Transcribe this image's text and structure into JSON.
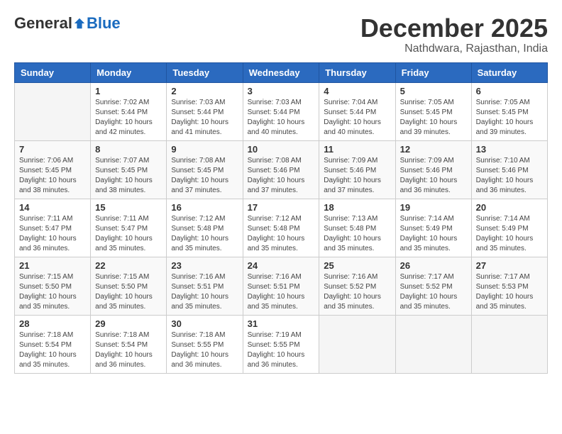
{
  "logo": {
    "general": "General",
    "blue": "Blue"
  },
  "header": {
    "month": "December 2025",
    "location": "Nathdwara, Rajasthan, India"
  },
  "weekdays": [
    "Sunday",
    "Monday",
    "Tuesday",
    "Wednesday",
    "Thursday",
    "Friday",
    "Saturday"
  ],
  "weeks": [
    [
      {
        "day": "",
        "info": ""
      },
      {
        "day": "1",
        "info": "Sunrise: 7:02 AM\nSunset: 5:44 PM\nDaylight: 10 hours\nand 42 minutes."
      },
      {
        "day": "2",
        "info": "Sunrise: 7:03 AM\nSunset: 5:44 PM\nDaylight: 10 hours\nand 41 minutes."
      },
      {
        "day": "3",
        "info": "Sunrise: 7:03 AM\nSunset: 5:44 PM\nDaylight: 10 hours\nand 40 minutes."
      },
      {
        "day": "4",
        "info": "Sunrise: 7:04 AM\nSunset: 5:44 PM\nDaylight: 10 hours\nand 40 minutes."
      },
      {
        "day": "5",
        "info": "Sunrise: 7:05 AM\nSunset: 5:45 PM\nDaylight: 10 hours\nand 39 minutes."
      },
      {
        "day": "6",
        "info": "Sunrise: 7:05 AM\nSunset: 5:45 PM\nDaylight: 10 hours\nand 39 minutes."
      }
    ],
    [
      {
        "day": "7",
        "info": "Sunrise: 7:06 AM\nSunset: 5:45 PM\nDaylight: 10 hours\nand 38 minutes."
      },
      {
        "day": "8",
        "info": "Sunrise: 7:07 AM\nSunset: 5:45 PM\nDaylight: 10 hours\nand 38 minutes."
      },
      {
        "day": "9",
        "info": "Sunrise: 7:08 AM\nSunset: 5:45 PM\nDaylight: 10 hours\nand 37 minutes."
      },
      {
        "day": "10",
        "info": "Sunrise: 7:08 AM\nSunset: 5:46 PM\nDaylight: 10 hours\nand 37 minutes."
      },
      {
        "day": "11",
        "info": "Sunrise: 7:09 AM\nSunset: 5:46 PM\nDaylight: 10 hours\nand 37 minutes."
      },
      {
        "day": "12",
        "info": "Sunrise: 7:09 AM\nSunset: 5:46 PM\nDaylight: 10 hours\nand 36 minutes."
      },
      {
        "day": "13",
        "info": "Sunrise: 7:10 AM\nSunset: 5:46 PM\nDaylight: 10 hours\nand 36 minutes."
      }
    ],
    [
      {
        "day": "14",
        "info": "Sunrise: 7:11 AM\nSunset: 5:47 PM\nDaylight: 10 hours\nand 36 minutes."
      },
      {
        "day": "15",
        "info": "Sunrise: 7:11 AM\nSunset: 5:47 PM\nDaylight: 10 hours\nand 35 minutes."
      },
      {
        "day": "16",
        "info": "Sunrise: 7:12 AM\nSunset: 5:48 PM\nDaylight: 10 hours\nand 35 minutes."
      },
      {
        "day": "17",
        "info": "Sunrise: 7:12 AM\nSunset: 5:48 PM\nDaylight: 10 hours\nand 35 minutes."
      },
      {
        "day": "18",
        "info": "Sunrise: 7:13 AM\nSunset: 5:48 PM\nDaylight: 10 hours\nand 35 minutes."
      },
      {
        "day": "19",
        "info": "Sunrise: 7:14 AM\nSunset: 5:49 PM\nDaylight: 10 hours\nand 35 minutes."
      },
      {
        "day": "20",
        "info": "Sunrise: 7:14 AM\nSunset: 5:49 PM\nDaylight: 10 hours\nand 35 minutes."
      }
    ],
    [
      {
        "day": "21",
        "info": "Sunrise: 7:15 AM\nSunset: 5:50 PM\nDaylight: 10 hours\nand 35 minutes."
      },
      {
        "day": "22",
        "info": "Sunrise: 7:15 AM\nSunset: 5:50 PM\nDaylight: 10 hours\nand 35 minutes."
      },
      {
        "day": "23",
        "info": "Sunrise: 7:16 AM\nSunset: 5:51 PM\nDaylight: 10 hours\nand 35 minutes."
      },
      {
        "day": "24",
        "info": "Sunrise: 7:16 AM\nSunset: 5:51 PM\nDaylight: 10 hours\nand 35 minutes."
      },
      {
        "day": "25",
        "info": "Sunrise: 7:16 AM\nSunset: 5:52 PM\nDaylight: 10 hours\nand 35 minutes."
      },
      {
        "day": "26",
        "info": "Sunrise: 7:17 AM\nSunset: 5:52 PM\nDaylight: 10 hours\nand 35 minutes."
      },
      {
        "day": "27",
        "info": "Sunrise: 7:17 AM\nSunset: 5:53 PM\nDaylight: 10 hours\nand 35 minutes."
      }
    ],
    [
      {
        "day": "28",
        "info": "Sunrise: 7:18 AM\nSunset: 5:54 PM\nDaylight: 10 hours\nand 35 minutes."
      },
      {
        "day": "29",
        "info": "Sunrise: 7:18 AM\nSunset: 5:54 PM\nDaylight: 10 hours\nand 36 minutes."
      },
      {
        "day": "30",
        "info": "Sunrise: 7:18 AM\nSunset: 5:55 PM\nDaylight: 10 hours\nand 36 minutes."
      },
      {
        "day": "31",
        "info": "Sunrise: 7:19 AM\nSunset: 5:55 PM\nDaylight: 10 hours\nand 36 minutes."
      },
      {
        "day": "",
        "info": ""
      },
      {
        "day": "",
        "info": ""
      },
      {
        "day": "",
        "info": ""
      }
    ]
  ]
}
